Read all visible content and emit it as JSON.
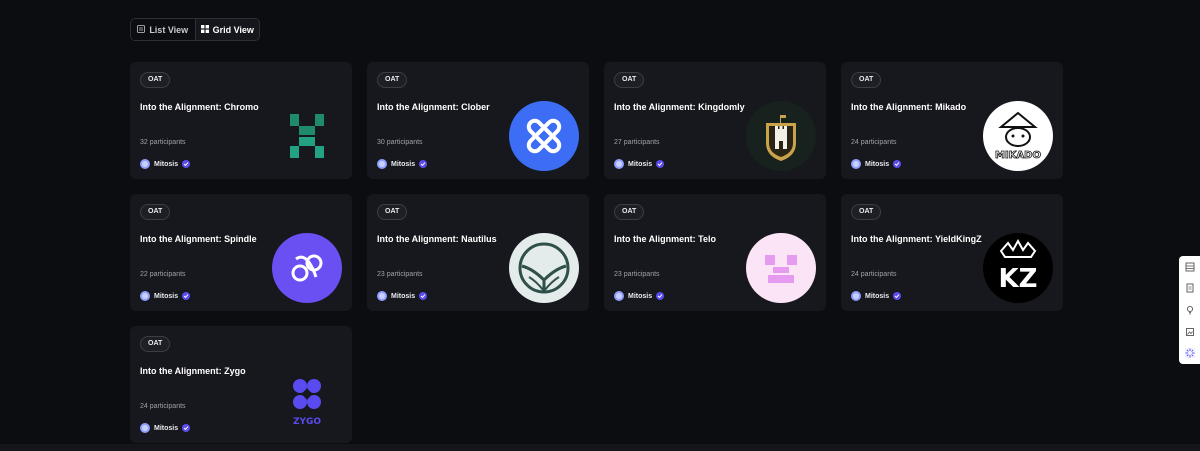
{
  "view_toggle": {
    "list_label": "List View",
    "grid_label": "Grid View",
    "active": "grid"
  },
  "cards": [
    {
      "badge": "OAT",
      "title": "Into the Alignment: Chromo",
      "participants": "32 participants",
      "org": "Mitosis",
      "logo": "chromo-logo"
    },
    {
      "badge": "OAT",
      "title": "Into the Alignment: Clober",
      "participants": "30 participants",
      "org": "Mitosis",
      "logo": "clober-logo"
    },
    {
      "badge": "OAT",
      "title": "Into the Alignment: Kingdomly",
      "participants": "27 participants",
      "org": "Mitosis",
      "logo": "kingdomly-logo"
    },
    {
      "badge": "OAT",
      "title": "Into the Alignment: Mikado",
      "participants": "24 participants",
      "org": "Mitosis",
      "logo": "mikado-logo",
      "logo_text": "MIKADO"
    },
    {
      "badge": "OAT",
      "title": "Into the Alignment: Spindle",
      "participants": "22 participants",
      "org": "Mitosis",
      "logo": "spindle-logo"
    },
    {
      "badge": "OAT",
      "title": "Into the Alignment: Nautilus",
      "participants": "23 participants",
      "org": "Mitosis",
      "logo": "nautilus-logo"
    },
    {
      "badge": "OAT",
      "title": "Into the Alignment: Telo",
      "participants": "23 participants",
      "org": "Mitosis",
      "logo": "telo-logo"
    },
    {
      "badge": "OAT",
      "title": "Into the Alignment: YieldKingZ",
      "participants": "24 participants",
      "org": "Mitosis",
      "logo": "yieldkingz-logo",
      "logo_text": "KZ"
    },
    {
      "badge": "OAT",
      "title": "Into the Alignment: Zygo",
      "participants": "24 participants",
      "org": "Mitosis",
      "logo": "zygo-logo",
      "logo_text": "ZYGO"
    }
  ],
  "colors": {
    "background": "#0c0d11",
    "card": "#17181d",
    "verified": "#5b4cf0",
    "clober_blue": "#3d6cf5",
    "spindle_purple": "#6a4ff2",
    "telo_pink": "#e49bf0",
    "chromo_green": "#1f8a6e"
  },
  "side_toolbar": [
    "table-icon",
    "document-icon",
    "lightbulb-icon",
    "image-edit-icon",
    "sparkle-icon"
  ]
}
